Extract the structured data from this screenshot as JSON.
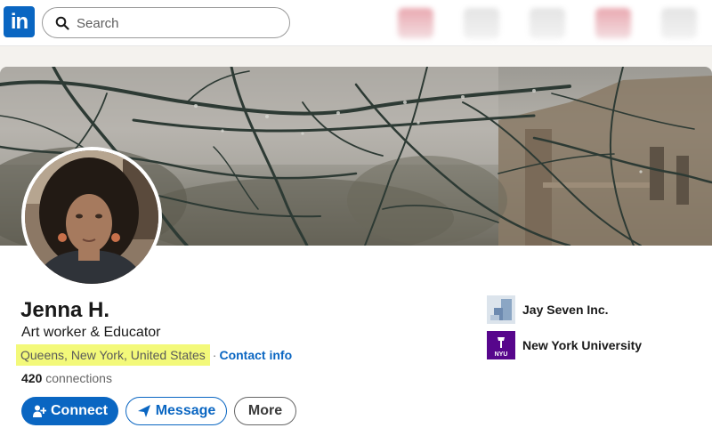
{
  "nav": {
    "logo": "in",
    "search_placeholder": "Search"
  },
  "profile": {
    "name": "Jenna H.",
    "headline": "Art worker & Educator",
    "location": "Queens, New York, United States",
    "separator": "·",
    "contact_info": "Contact info",
    "connections_count": "420",
    "connections_label": "connections"
  },
  "actions": {
    "connect": "Connect",
    "message": "Message",
    "more": "More"
  },
  "experience": [
    {
      "name": "Jay Seven Inc."
    },
    {
      "name": "New York University",
      "logo_text": "NYU"
    }
  ],
  "colors": {
    "brand": "#0a66c2",
    "highlight": "#f3f97a",
    "nyu_purple": "#57068c"
  }
}
